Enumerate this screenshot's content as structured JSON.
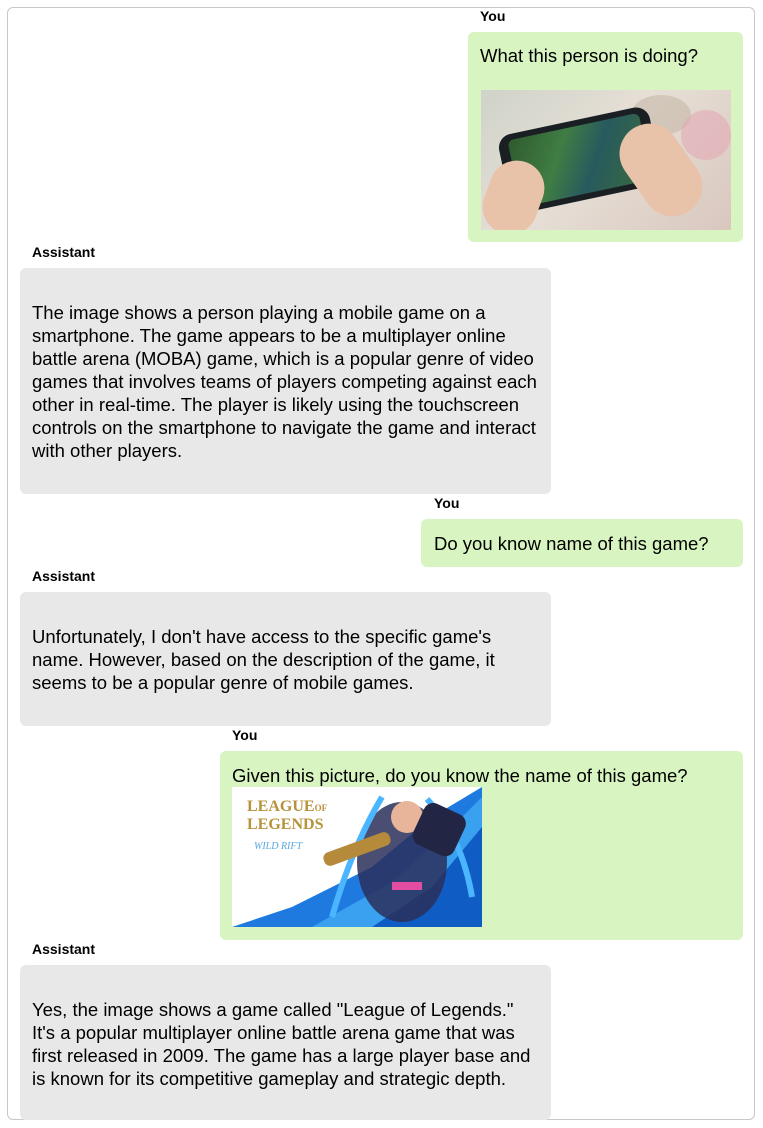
{
  "messages": [
    {
      "speaker": "You",
      "text": "What this person is doing?",
      "image": "person-playing-mobile-game-photo"
    },
    {
      "speaker": "Assistant",
      "text": "The image shows a person playing a mobile game on a smartphone. The game appears to be a multiplayer online battle arena (MOBA) game, which is a popular genre of video games that involves teams of players competing against each other in real-time. The player is likely using the touchscreen controls on the smartphone to navigate the game and interact with other players."
    },
    {
      "speaker": "You",
      "text": "Do you know name of this game?"
    },
    {
      "speaker": "Assistant",
      "text": "Unfortunately, I don't have access to the specific game's name. However, based on the description of the game, it seems to be a popular genre of mobile games."
    },
    {
      "speaker": "You",
      "text": "Given this picture, do you know the name of this game?",
      "image": "league-of-legends-wild-rift-poster",
      "image_text": {
        "line1": "LEAGUE",
        "of": "OF",
        "line2": "LEGENDS",
        "line3": "WILD RIFT"
      }
    },
    {
      "speaker": "Assistant",
      "text": "Yes, the image shows a game called \"League of Legends.\" It's a popular multiplayer online battle arena game that was first released in 2009. The game has a large player base and is known for its competitive gameplay and strategic depth."
    }
  ],
  "colors": {
    "user_bubble": "#d8f5c1",
    "assistant_bubble": "#e8e8e8",
    "poster_blue": "#1f7ae0"
  }
}
